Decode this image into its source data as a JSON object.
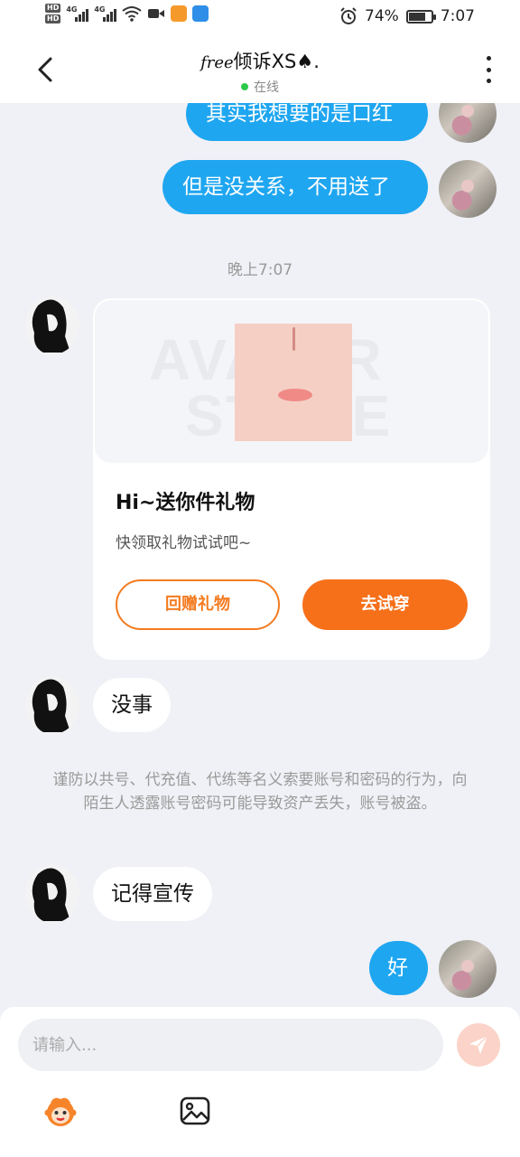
{
  "status_bar": {
    "battery_percent": "74%",
    "battery_level": 0.74,
    "time": "7:07",
    "network_labels": [
      "HD",
      "HD",
      "4G",
      "4G"
    ]
  },
  "header": {
    "title_script": "free",
    "title_main": "倾诉XS♠.",
    "online_status": "在线"
  },
  "messages": {
    "out_1": "其实我想要的是口红",
    "out_2": "但是没关系，不用送了",
    "timestamp": "晚上7:07",
    "in_1": "没事",
    "in_2": "记得宣传",
    "out_3": "好"
  },
  "gift_card": {
    "watermark_line1": "AVATAR",
    "watermark_line2": "STORE",
    "title": "Hi~送你件礼物",
    "subtitle": "快领取礼物试试吧~",
    "return_gift_label": "回赠礼物",
    "try_on_label": "去试穿"
  },
  "safety_notice": "谨防以共号、代充值、代练等名义索要账号和密码的行为，向陌生人透露账号密码可能导致资产丢失，账号被盗。",
  "input_bar": {
    "placeholder": "请输入..."
  },
  "colors": {
    "accent_blue": "#1fa6f0",
    "accent_orange": "#f6701a",
    "background": "#f0f1f6",
    "online_green": "#2cc94b"
  },
  "icons": [
    "back-arrow-icon",
    "more-icon",
    "send-icon",
    "emoji-icon",
    "image-icon",
    "alarm-icon",
    "wifi-icon",
    "video-icon"
  ]
}
